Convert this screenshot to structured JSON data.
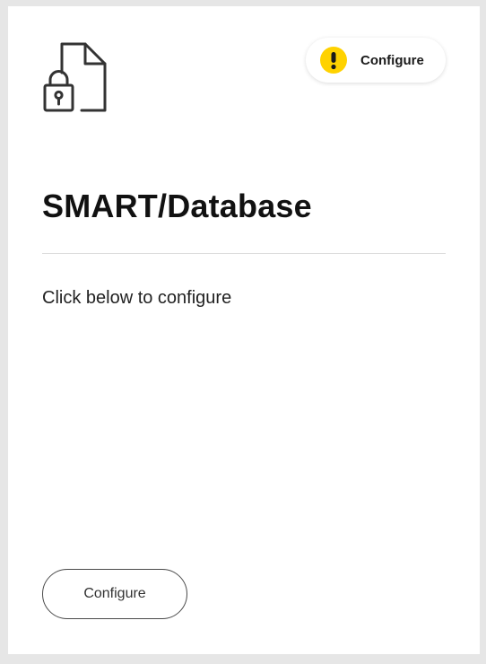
{
  "card": {
    "icon": "document-lock-icon",
    "status": {
      "icon": "warning-icon",
      "icon_color": "#ffd200",
      "label": "Configure"
    },
    "title": "SMART/Database",
    "description": "Click below to configure",
    "button_label": "Configure"
  }
}
